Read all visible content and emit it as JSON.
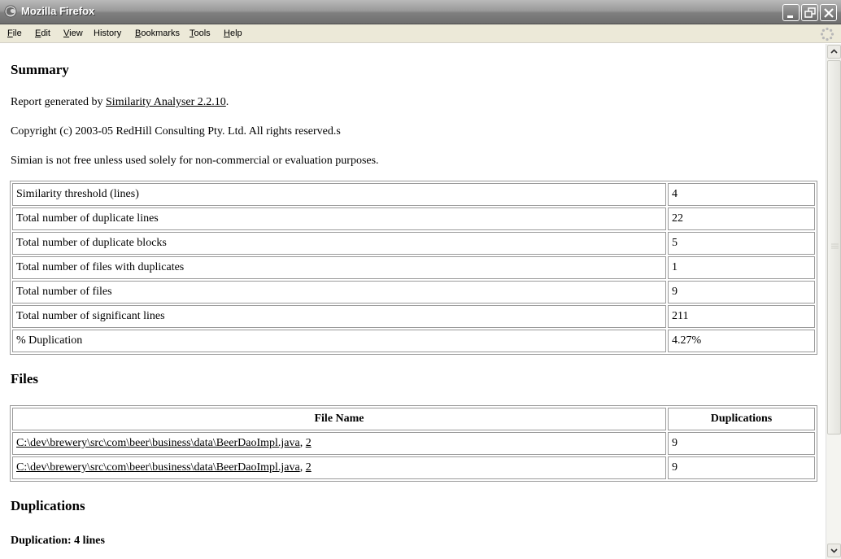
{
  "window": {
    "title": "Mozilla Firefox"
  },
  "menu": {
    "items": [
      {
        "label": "File",
        "mn": "F",
        "rest": "ile"
      },
      {
        "label": "Edit",
        "mn": "E",
        "rest": "dit"
      },
      {
        "label": "View",
        "mn": "V",
        "rest": "iew"
      },
      {
        "label": "History",
        "mn": "",
        "rest": "History"
      },
      {
        "label": "Bookmarks",
        "mn": "B",
        "rest": "ookmarks"
      },
      {
        "label": "Tools",
        "mn": "T",
        "rest": "ools"
      },
      {
        "label": "Help",
        "mn": "H",
        "rest": "elp"
      }
    ]
  },
  "summary": {
    "heading": "Summary",
    "generated_prefix": "Report generated by ",
    "generated_link": "Similarity Analyser 2.2.10",
    "generated_suffix": ".",
    "copyright": "Copyright (c) 2003-05 RedHill Consulting Pty. Ltd. All rights reserved.s",
    "notice": "Simian is not free unless used solely for non-commercial or evaluation purposes.",
    "rows": [
      {
        "label": "Similarity threshold (lines)",
        "value": "4"
      },
      {
        "label": "Total number of duplicate lines",
        "value": "22"
      },
      {
        "label": "Total number of duplicate blocks",
        "value": "5"
      },
      {
        "label": "Total number of files with duplicates",
        "value": "1"
      },
      {
        "label": "Total number of files",
        "value": "9"
      },
      {
        "label": "Total number of significant lines",
        "value": "211"
      },
      {
        "label": "% Duplication",
        "value": "4.27%"
      }
    ]
  },
  "files": {
    "heading": "Files",
    "col_file": "File Name",
    "col_dup": "Duplications",
    "rows": [
      {
        "path": "C:\\dev\\brewery\\src\\com\\beer\\business\\data\\BeerDaoImpl.java",
        "sep": ", ",
        "num": "2",
        "dup": "9"
      },
      {
        "path": "C:\\dev\\brewery\\src\\com\\beer\\business\\data\\BeerDaoImpl.java",
        "sep": ", ",
        "num": "2",
        "dup": "9"
      }
    ]
  },
  "duplications": {
    "heading": "Duplications",
    "sub": "Duplication: 4 lines"
  }
}
